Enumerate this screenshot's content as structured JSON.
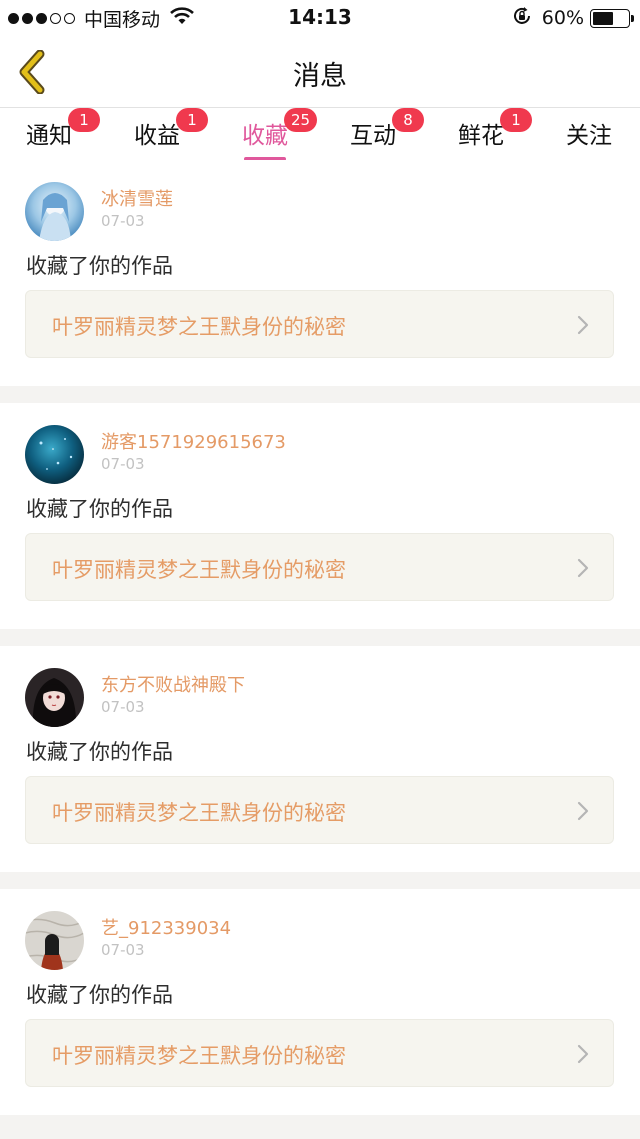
{
  "status": {
    "carrier": "中国移动",
    "time": "14:13",
    "battery_pct": "60%",
    "battery_level": 0.6
  },
  "nav": {
    "title": "消息",
    "back_icon": "chevron-left-icon"
  },
  "tabs": [
    {
      "label": "通知",
      "badge": "1",
      "active": false
    },
    {
      "label": "收益",
      "badge": "1",
      "active": false
    },
    {
      "label": "收藏",
      "badge": "25",
      "active": true
    },
    {
      "label": "互动",
      "badge": "8",
      "active": false
    },
    {
      "label": "鲜花",
      "badge": "1",
      "active": false
    },
    {
      "label": "关注",
      "badge": "",
      "active": false
    }
  ],
  "messages": [
    {
      "username": "冰清雪莲",
      "date": "07-03",
      "action": "收藏了你的作品",
      "work_title": "叶罗丽精灵梦之王默身份的秘密"
    },
    {
      "username": "游客1571929615673",
      "date": "07-03",
      "action": "收藏了你的作品",
      "work_title": "叶罗丽精灵梦之王默身份的秘密"
    },
    {
      "username": "东方不败战神殿下",
      "date": "07-03",
      "action": "收藏了你的作品",
      "work_title": "叶罗丽精灵梦之王默身份的秘密"
    },
    {
      "username": "艺_912339034",
      "date": "07-03",
      "action": "收藏了你的作品",
      "work_title": "叶罗丽精灵梦之王默身份的秘密"
    }
  ],
  "colors": {
    "accent": "#e0589c",
    "badge": "#f0394e",
    "username": "#e49a66",
    "back_icon": "#d8b000"
  }
}
